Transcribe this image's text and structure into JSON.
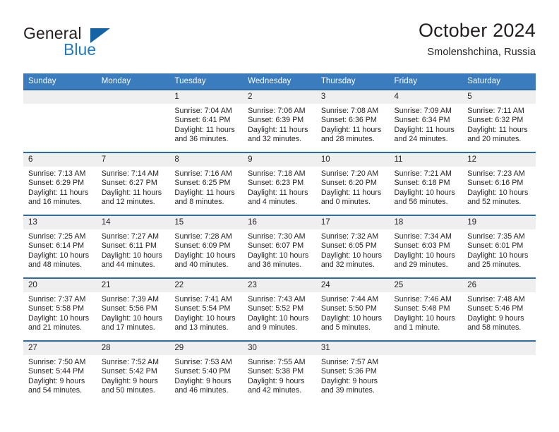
{
  "brand": {
    "name_part1": "General",
    "name_part2": "Blue",
    "triangle_color": "#1464a5",
    "blue_color": "#1f7ac0"
  },
  "header": {
    "title": "October 2024",
    "location": "Smolenshchina, Russia"
  },
  "theme": {
    "header_bg": "#3a7cbe",
    "row_border": "#2e6da4",
    "daynum_bg": "#efefef",
    "text": "#231f20"
  },
  "weekdays": [
    "Sunday",
    "Monday",
    "Tuesday",
    "Wednesday",
    "Thursday",
    "Friday",
    "Saturday"
  ],
  "labels": {
    "sunrise_prefix": "Sunrise:",
    "sunset_prefix": "Sunset:",
    "daylight_prefix": "Daylight:"
  },
  "weeks": [
    [
      {
        "day": "",
        "empty": true
      },
      {
        "day": "",
        "empty": true
      },
      {
        "day": "1",
        "sunrise": "Sunrise: 7:04 AM",
        "sunset": "Sunset: 6:41 PM",
        "daylight_line1": "Daylight: 11 hours",
        "daylight_line2": "and 36 minutes."
      },
      {
        "day": "2",
        "sunrise": "Sunrise: 7:06 AM",
        "sunset": "Sunset: 6:39 PM",
        "daylight_line1": "Daylight: 11 hours",
        "daylight_line2": "and 32 minutes."
      },
      {
        "day": "3",
        "sunrise": "Sunrise: 7:08 AM",
        "sunset": "Sunset: 6:36 PM",
        "daylight_line1": "Daylight: 11 hours",
        "daylight_line2": "and 28 minutes."
      },
      {
        "day": "4",
        "sunrise": "Sunrise: 7:09 AM",
        "sunset": "Sunset: 6:34 PM",
        "daylight_line1": "Daylight: 11 hours",
        "daylight_line2": "and 24 minutes."
      },
      {
        "day": "5",
        "sunrise": "Sunrise: 7:11 AM",
        "sunset": "Sunset: 6:32 PM",
        "daylight_line1": "Daylight: 11 hours",
        "daylight_line2": "and 20 minutes."
      }
    ],
    [
      {
        "day": "6",
        "sunrise": "Sunrise: 7:13 AM",
        "sunset": "Sunset: 6:29 PM",
        "daylight_line1": "Daylight: 11 hours",
        "daylight_line2": "and 16 minutes."
      },
      {
        "day": "7",
        "sunrise": "Sunrise: 7:14 AM",
        "sunset": "Sunset: 6:27 PM",
        "daylight_line1": "Daylight: 11 hours",
        "daylight_line2": "and 12 minutes."
      },
      {
        "day": "8",
        "sunrise": "Sunrise: 7:16 AM",
        "sunset": "Sunset: 6:25 PM",
        "daylight_line1": "Daylight: 11 hours",
        "daylight_line2": "and 8 minutes."
      },
      {
        "day": "9",
        "sunrise": "Sunrise: 7:18 AM",
        "sunset": "Sunset: 6:23 PM",
        "daylight_line1": "Daylight: 11 hours",
        "daylight_line2": "and 4 minutes."
      },
      {
        "day": "10",
        "sunrise": "Sunrise: 7:20 AM",
        "sunset": "Sunset: 6:20 PM",
        "daylight_line1": "Daylight: 11 hours",
        "daylight_line2": "and 0 minutes."
      },
      {
        "day": "11",
        "sunrise": "Sunrise: 7:21 AM",
        "sunset": "Sunset: 6:18 PM",
        "daylight_line1": "Daylight: 10 hours",
        "daylight_line2": "and 56 minutes."
      },
      {
        "day": "12",
        "sunrise": "Sunrise: 7:23 AM",
        "sunset": "Sunset: 6:16 PM",
        "daylight_line1": "Daylight: 10 hours",
        "daylight_line2": "and 52 minutes."
      }
    ],
    [
      {
        "day": "13",
        "sunrise": "Sunrise: 7:25 AM",
        "sunset": "Sunset: 6:14 PM",
        "daylight_line1": "Daylight: 10 hours",
        "daylight_line2": "and 48 minutes."
      },
      {
        "day": "14",
        "sunrise": "Sunrise: 7:27 AM",
        "sunset": "Sunset: 6:11 PM",
        "daylight_line1": "Daylight: 10 hours",
        "daylight_line2": "and 44 minutes."
      },
      {
        "day": "15",
        "sunrise": "Sunrise: 7:28 AM",
        "sunset": "Sunset: 6:09 PM",
        "daylight_line1": "Daylight: 10 hours",
        "daylight_line2": "and 40 minutes."
      },
      {
        "day": "16",
        "sunrise": "Sunrise: 7:30 AM",
        "sunset": "Sunset: 6:07 PM",
        "daylight_line1": "Daylight: 10 hours",
        "daylight_line2": "and 36 minutes."
      },
      {
        "day": "17",
        "sunrise": "Sunrise: 7:32 AM",
        "sunset": "Sunset: 6:05 PM",
        "daylight_line1": "Daylight: 10 hours",
        "daylight_line2": "and 32 minutes."
      },
      {
        "day": "18",
        "sunrise": "Sunrise: 7:34 AM",
        "sunset": "Sunset: 6:03 PM",
        "daylight_line1": "Daylight: 10 hours",
        "daylight_line2": "and 29 minutes."
      },
      {
        "day": "19",
        "sunrise": "Sunrise: 7:35 AM",
        "sunset": "Sunset: 6:01 PM",
        "daylight_line1": "Daylight: 10 hours",
        "daylight_line2": "and 25 minutes."
      }
    ],
    [
      {
        "day": "20",
        "sunrise": "Sunrise: 7:37 AM",
        "sunset": "Sunset: 5:58 PM",
        "daylight_line1": "Daylight: 10 hours",
        "daylight_line2": "and 21 minutes."
      },
      {
        "day": "21",
        "sunrise": "Sunrise: 7:39 AM",
        "sunset": "Sunset: 5:56 PM",
        "daylight_line1": "Daylight: 10 hours",
        "daylight_line2": "and 17 minutes."
      },
      {
        "day": "22",
        "sunrise": "Sunrise: 7:41 AM",
        "sunset": "Sunset: 5:54 PM",
        "daylight_line1": "Daylight: 10 hours",
        "daylight_line2": "and 13 minutes."
      },
      {
        "day": "23",
        "sunrise": "Sunrise: 7:43 AM",
        "sunset": "Sunset: 5:52 PM",
        "daylight_line1": "Daylight: 10 hours",
        "daylight_line2": "and 9 minutes."
      },
      {
        "day": "24",
        "sunrise": "Sunrise: 7:44 AM",
        "sunset": "Sunset: 5:50 PM",
        "daylight_line1": "Daylight: 10 hours",
        "daylight_line2": "and 5 minutes."
      },
      {
        "day": "25",
        "sunrise": "Sunrise: 7:46 AM",
        "sunset": "Sunset: 5:48 PM",
        "daylight_line1": "Daylight: 10 hours",
        "daylight_line2": "and 1 minute."
      },
      {
        "day": "26",
        "sunrise": "Sunrise: 7:48 AM",
        "sunset": "Sunset: 5:46 PM",
        "daylight_line1": "Daylight: 9 hours",
        "daylight_line2": "and 58 minutes."
      }
    ],
    [
      {
        "day": "27",
        "sunrise": "Sunrise: 7:50 AM",
        "sunset": "Sunset: 5:44 PM",
        "daylight_line1": "Daylight: 9 hours",
        "daylight_line2": "and 54 minutes."
      },
      {
        "day": "28",
        "sunrise": "Sunrise: 7:52 AM",
        "sunset": "Sunset: 5:42 PM",
        "daylight_line1": "Daylight: 9 hours",
        "daylight_line2": "and 50 minutes."
      },
      {
        "day": "29",
        "sunrise": "Sunrise: 7:53 AM",
        "sunset": "Sunset: 5:40 PM",
        "daylight_line1": "Daylight: 9 hours",
        "daylight_line2": "and 46 minutes."
      },
      {
        "day": "30",
        "sunrise": "Sunrise: 7:55 AM",
        "sunset": "Sunset: 5:38 PM",
        "daylight_line1": "Daylight: 9 hours",
        "daylight_line2": "and 42 minutes."
      },
      {
        "day": "31",
        "sunrise": "Sunrise: 7:57 AM",
        "sunset": "Sunset: 5:36 PM",
        "daylight_line1": "Daylight: 9 hours",
        "daylight_line2": "and 39 minutes."
      },
      {
        "day": "",
        "empty": true
      },
      {
        "day": "",
        "empty": true
      }
    ]
  ]
}
